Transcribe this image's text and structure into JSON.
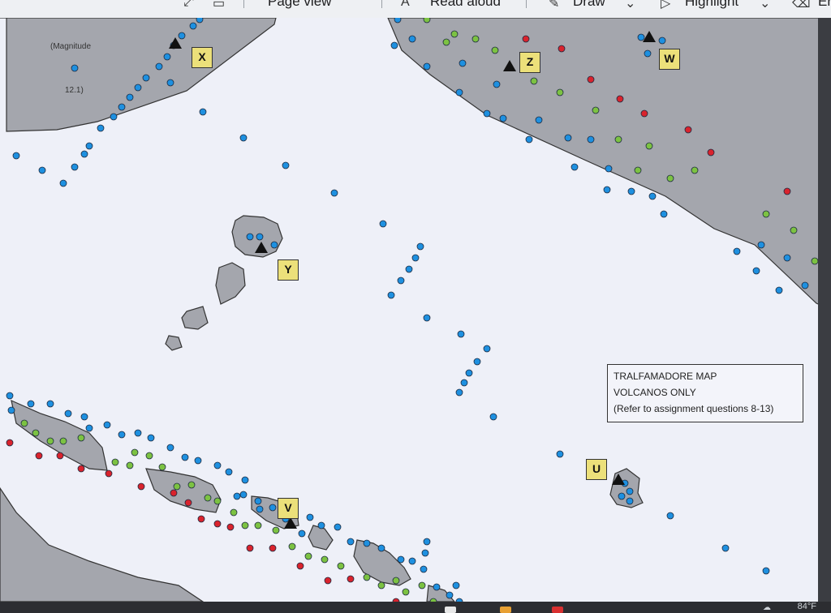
{
  "toolbar": {
    "items": [
      "Page view",
      "Read aloud",
      "Draw",
      "Highlight",
      "Er"
    ]
  },
  "map": {
    "title_line1": "TRALFAMADORE MAP",
    "title_line2": "VOLCANOS ONLY",
    "title_line3": "(Refer to assignment questions 8-13)",
    "magnitude_label": "(Magnitude",
    "magnitude_value": "12.1)",
    "volcano_labels": [
      "X",
      "Y",
      "Z",
      "W",
      "U",
      "V"
    ],
    "colors": {
      "blue_quake": "#1e90e0",
      "green_quake": "#7cc242",
      "red_quake": "#d9232d",
      "plate": "#a4a6ad",
      "ocean": "#eef0f8",
      "label_box": "#ece07a"
    }
  },
  "taskbar": {
    "temperature": "84°F"
  }
}
